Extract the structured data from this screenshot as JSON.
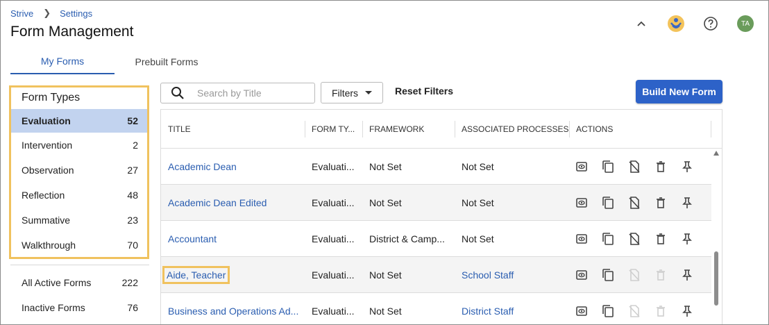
{
  "breadcrumb": {
    "root": "Strive",
    "current": "Settings"
  },
  "page": {
    "title": "Form Management"
  },
  "header": {
    "avatar_initials": "TA",
    "icons": [
      "chevron-up-icon",
      "app-logo-icon",
      "help-icon"
    ]
  },
  "tabs": [
    {
      "label": "My Forms",
      "active": true
    },
    {
      "label": "Prebuilt Forms",
      "active": false
    }
  ],
  "form_types": {
    "heading": "Form Types",
    "items": [
      {
        "label": "Evaluation",
        "count": "52",
        "selected": true
      },
      {
        "label": "Intervention",
        "count": "2"
      },
      {
        "label": "Observation",
        "count": "27"
      },
      {
        "label": "Reflection",
        "count": "48"
      },
      {
        "label": "Summative",
        "count": "23"
      },
      {
        "label": "Walkthrough",
        "count": "70"
      }
    ]
  },
  "other_filters": [
    {
      "label": "All Active Forms",
      "count": "222"
    },
    {
      "label": "Inactive Forms",
      "count": "76"
    }
  ],
  "toolbar": {
    "search_placeholder": "Search by Title",
    "filters_label": "Filters",
    "reset_label": "Reset Filters",
    "build_label": "Build New Form"
  },
  "table": {
    "columns": [
      "TITLE",
      "FORM TY...",
      "FRAMEWORK",
      "ASSOCIATED PROCESSES",
      "ACTIONS"
    ],
    "rows": [
      {
        "title": "Academic Dean",
        "form_type": "Evaluati...",
        "framework": "Not Set",
        "processes": "Not Set",
        "processes_link": false
      },
      {
        "title": "Academic Dean Edited",
        "form_type": "Evaluati...",
        "framework": "Not Set",
        "processes": "Not Set",
        "processes_link": false
      },
      {
        "title": "Accountant",
        "form_type": "Evaluati...",
        "framework": "District & Camp...",
        "processes": "Not Set",
        "processes_link": false
      },
      {
        "title": "Aide, Teacher",
        "form_type": "Evaluati...",
        "framework": "Not Set",
        "processes": "School Staff",
        "processes_link": true
      },
      {
        "title": "Business and Operations Ad...",
        "form_type": "Evaluati...",
        "framework": "Not Set",
        "processes": "District Staff",
        "processes_link": true
      }
    ]
  },
  "colors": {
    "accent": "#2a5db0",
    "button": "#2d62c8",
    "highlight": "#f0c25e",
    "selected_row": "#c2d3ef"
  }
}
